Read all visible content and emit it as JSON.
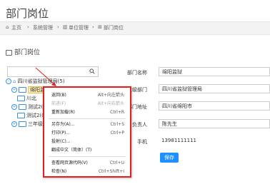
{
  "header": {
    "title": "部门岗位"
  },
  "breadcrumb": {
    "home": "主页",
    "sep": "›",
    "item1": "系统管理",
    "item2": "单位管理",
    "item3": "部门岗位"
  },
  "section": {
    "title": "部门岗位"
  },
  "tree": {
    "root": "四川省监狱管理局(5)",
    "items": [
      "绵阳监狱",
      "川北",
      "测试2(",
      "测试2(0",
      "三年级("
    ]
  },
  "form": {
    "dept_name_label": "部门名称",
    "dept_name_value": "绵阳监狱",
    "parent_label": "上级部门",
    "parent_value": "四川省监狱管理局",
    "address_label": "部门地址",
    "address_value": "四川省绵阳市",
    "contact_label": "负责人",
    "contact_value": "陈先生",
    "phone_label": "手机",
    "phone_value": "13981111111",
    "save_label": "保存"
  },
  "context_menu": {
    "items": [
      {
        "label": "返回(B)",
        "shortcut": "Alt+向左箭头",
        "disabled": false
      },
      {
        "label": "前进(F)",
        "shortcut": "Alt+向右箭头",
        "disabled": true
      },
      {
        "label": "重新加载(R)",
        "shortcut": "Ctrl+R",
        "disabled": false
      },
      {
        "label": "另存为(A)...",
        "shortcut": "Ctrl+S",
        "disabled": false
      },
      {
        "label": "打印(P)...",
        "shortcut": "Ctrl+P",
        "disabled": false
      },
      {
        "label": "投射(C)...",
        "shortcut": "",
        "disabled": false
      },
      {
        "label": "翻成中文（简体）(T)",
        "shortcut": "",
        "disabled": false
      },
      {
        "label": "查看网页源代码(V)",
        "shortcut": "Ctrl+U",
        "disabled": false
      },
      {
        "label": "检查(N)",
        "shortcut": "Ctrl+Shift+I",
        "disabled": false
      }
    ]
  },
  "colors": {
    "accent": "#1e90ff",
    "menu_border": "#e02020",
    "selection": "#ffefb5"
  }
}
